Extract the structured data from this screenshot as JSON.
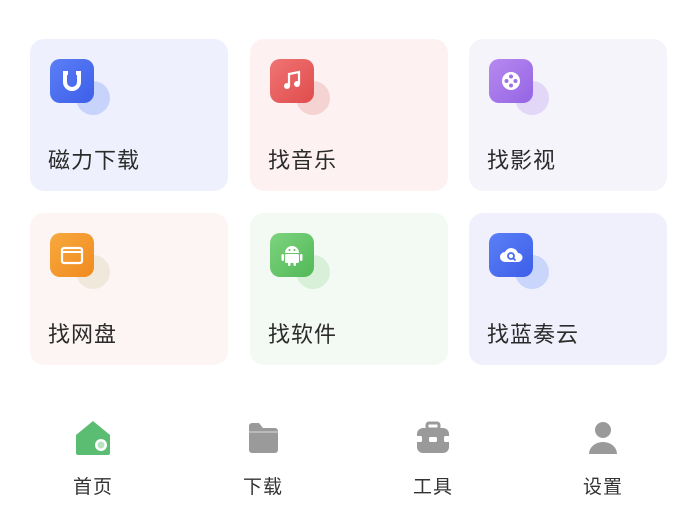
{
  "cards": [
    {
      "label": "磁力下载",
      "icon": "magnet-icon"
    },
    {
      "label": "找音乐",
      "icon": "music-note-icon"
    },
    {
      "label": "找影视",
      "icon": "film-reel-icon"
    },
    {
      "label": "找网盘",
      "icon": "folder-icon"
    },
    {
      "label": "找软件",
      "icon": "android-icon"
    },
    {
      "label": "找蓝奏云",
      "icon": "cloud-search-icon"
    }
  ],
  "tabs": [
    {
      "label": "首页",
      "icon": "home-icon",
      "active": true
    },
    {
      "label": "下载",
      "icon": "download-folder-icon"
    },
    {
      "label": "工具",
      "icon": "toolbox-icon"
    },
    {
      "label": "设置",
      "icon": "user-icon"
    }
  ],
  "colors": {
    "active_tab": "#5bbd72",
    "inactive_tab": "#9a9a9a"
  }
}
